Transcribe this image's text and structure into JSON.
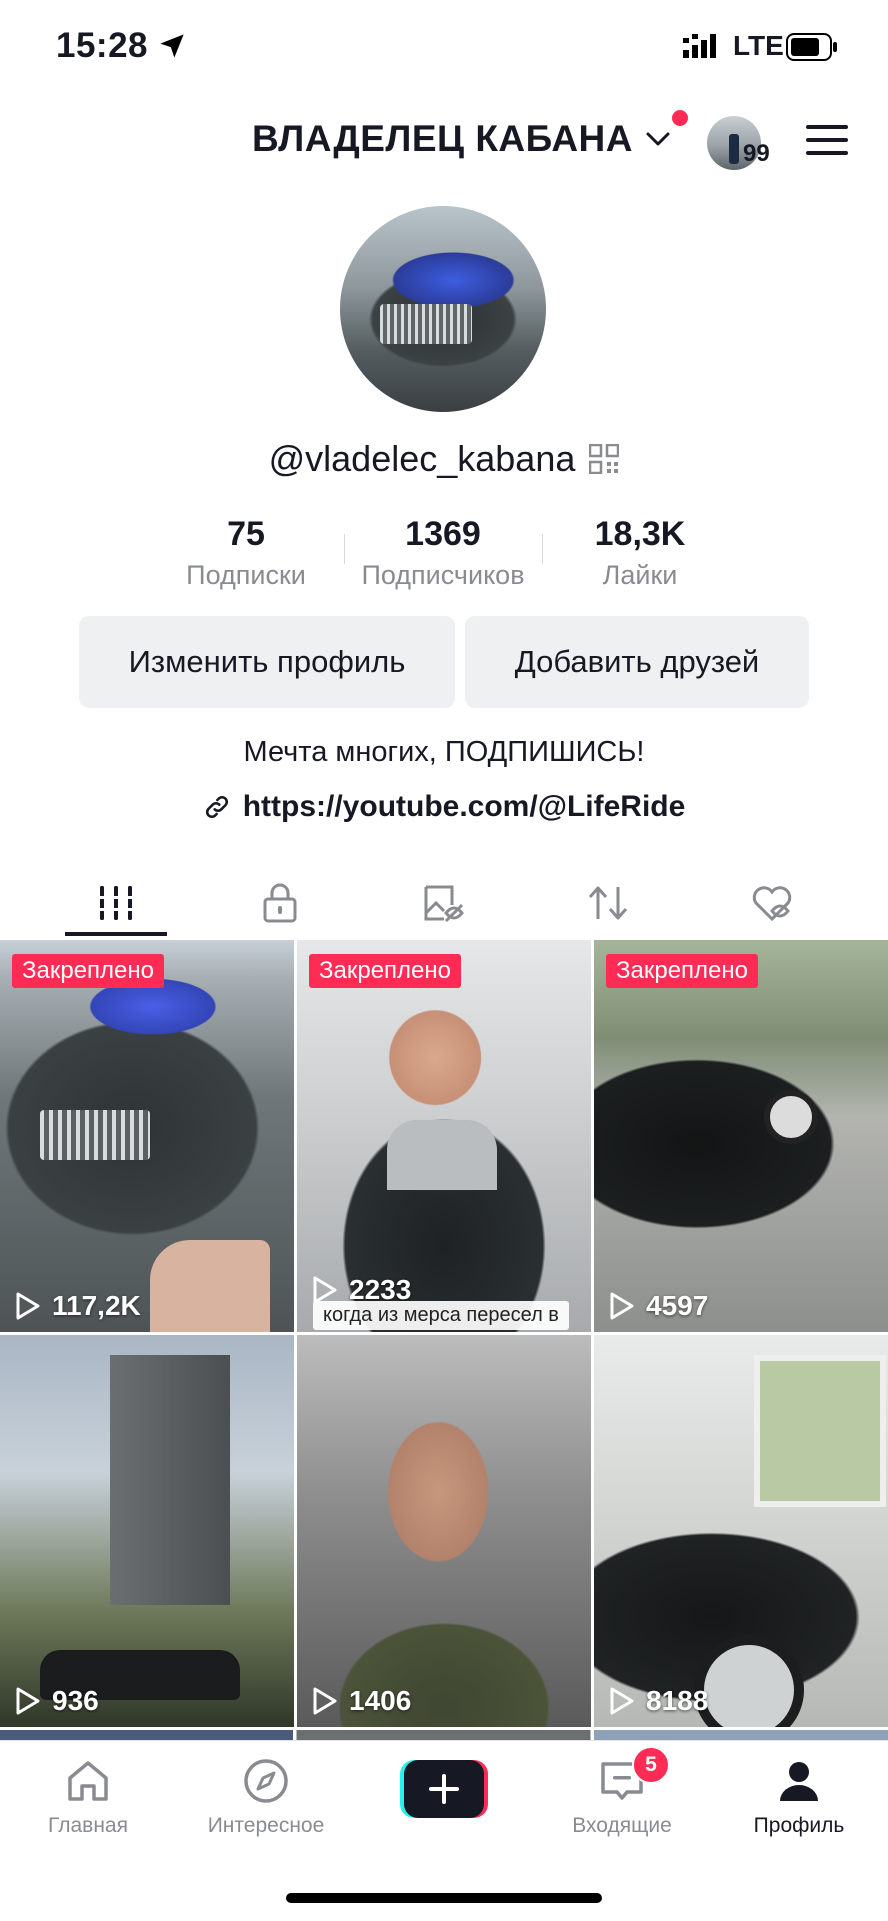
{
  "status_bar": {
    "time": "15:28",
    "network": "LTE"
  },
  "header": {
    "username_title": "ВЛАДЕЛЕЦ КАБАНА",
    "story_count": "99"
  },
  "profile": {
    "handle": "@vladelec_kabana",
    "stats": [
      {
        "value": "75",
        "label": "Подписки"
      },
      {
        "value": "1369",
        "label": "Подписчиков"
      },
      {
        "value": "18,3K",
        "label": "Лайки"
      }
    ],
    "edit_button": "Изменить профиль",
    "add_friends_button": "Добавить друзей",
    "bio": "Мечта многих, ПОДПИШИСЬ!",
    "link": "https://youtube.com/@LifeRide"
  },
  "tabs": [
    {
      "icon": "grid-icon",
      "active": true
    },
    {
      "icon": "lock-icon",
      "active": false
    },
    {
      "icon": "tagged-icon",
      "active": false
    },
    {
      "icon": "repost-icon",
      "active": false
    },
    {
      "icon": "liked-hidden-icon",
      "active": false
    }
  ],
  "videos": [
    {
      "views": "117,2K",
      "pinned": "Закреплено"
    },
    {
      "views": "2233",
      "pinned": "Закреплено",
      "caption": "когда из мерса пересел в"
    },
    {
      "views": "4597",
      "pinned": "Закреплено"
    },
    {
      "views": "936"
    },
    {
      "views": "1406"
    },
    {
      "views": "8188"
    }
  ],
  "bottom_nav": {
    "home": "Главная",
    "discover": "Интересное",
    "inbox": "Входящие",
    "inbox_badge": "5",
    "profile": "Профиль"
  },
  "colors": {
    "accent": "#fe2c55",
    "text": "#161823",
    "muted": "#8a8b91"
  }
}
